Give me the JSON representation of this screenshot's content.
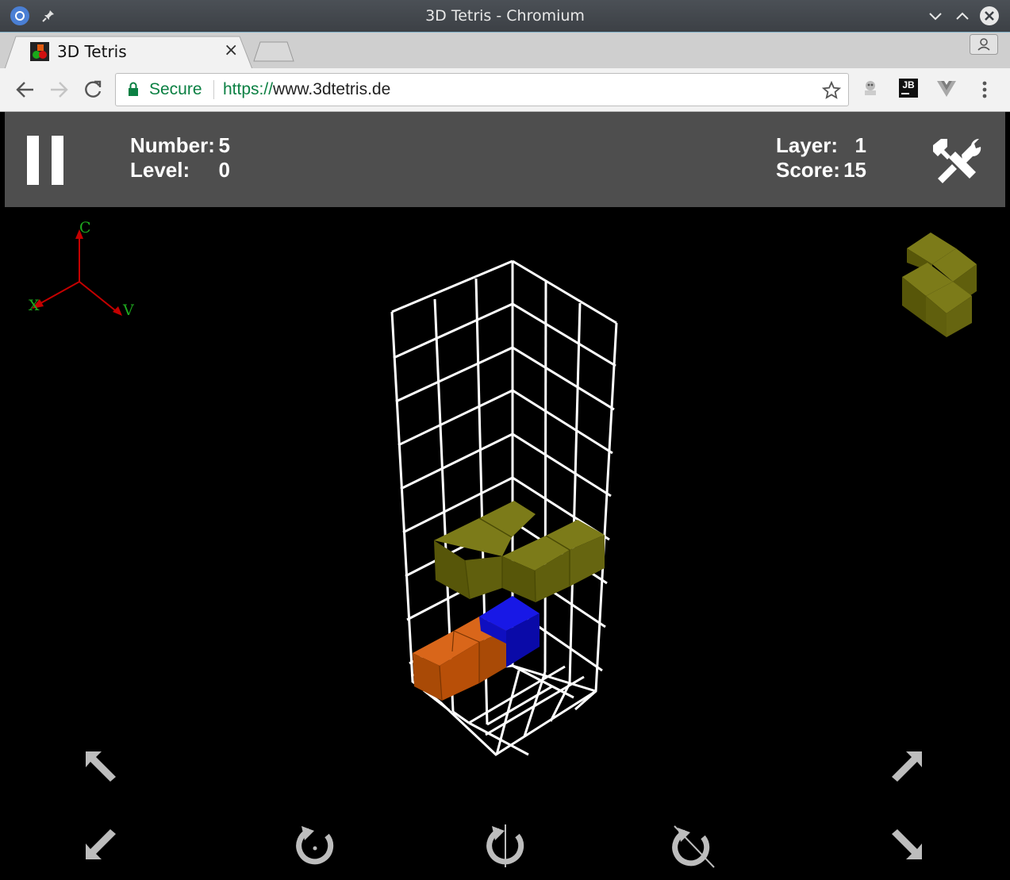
{
  "window": {
    "title": "3D Tetris - Chromium"
  },
  "tab": {
    "title": "3D Tetris",
    "close_glyph": "×"
  },
  "omnibox": {
    "security_label": "Secure",
    "url_scheme": "https://",
    "url_host": "www.3dtetris.de"
  },
  "toolbar_icons": [
    "back-arrow-icon",
    "forward-arrow-icon",
    "reload-icon",
    "star-icon",
    "extension-icon",
    "jetbrains-icon",
    "vue-devtools-icon",
    "menu-dots-icon"
  ],
  "extensions": {
    "jetbrains_text": "JB"
  },
  "hud": {
    "number_label": "Number:",
    "number_value": "5",
    "level_label": "Level:",
    "level_value": "0",
    "layer_label": "Layer:",
    "layer_value": "1",
    "score_label": "Score:",
    "score_value": "15"
  },
  "axes": {
    "c": "C",
    "x": "X",
    "v": "V"
  },
  "colors": {
    "hud_bg": "#4e4e4e",
    "olive_block": "#6b6a0f",
    "orange_block": "#c05a0c",
    "blue_block": "#0c0cd0",
    "axis_red": "#c40000",
    "axis_label_green": "#1ea81e",
    "control_gray": "#bdbdbd"
  },
  "controls": [
    "move-up-left-icon",
    "move-up-right-icon",
    "move-down-left-icon",
    "move-down-right-icon",
    "rotate-ccw-icon",
    "rotate-vertical-icon",
    "rotate-diagonal-icon",
    "pause-icon",
    "settings-icon"
  ]
}
